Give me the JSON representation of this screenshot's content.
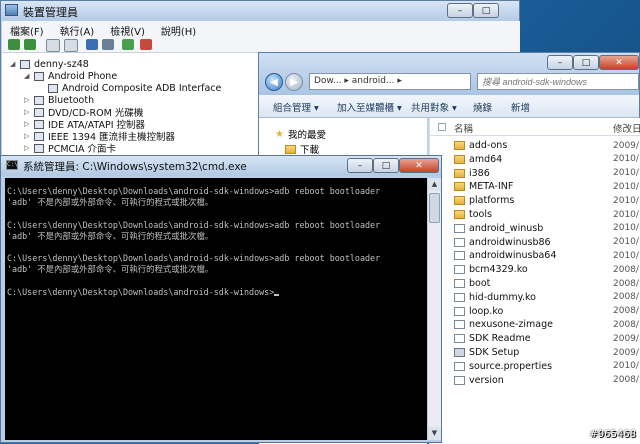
{
  "device_manager": {
    "title": "裝置管理員",
    "menu": [
      "檔案(F)",
      "執行(A)",
      "檢視(V)",
      "說明(H)"
    ],
    "toolbar_icons": [
      "back-arrow-icon",
      "forward-arrow-icon",
      "properties-icon",
      "help-icon",
      "scan-icon",
      "update-driver-icon",
      "uninstall-icon",
      "disable-icon"
    ],
    "tree": [
      {
        "label": "denny-sz48",
        "level": 0,
        "icon": "computer-icon"
      },
      {
        "label": "Android Phone",
        "level": 1,
        "icon": "phone-icon"
      },
      {
        "label": "Android Composite ADB Interface",
        "level": 2,
        "icon": "adb-device-icon"
      },
      {
        "label": "Bluetooth",
        "level": 1,
        "icon": "bluetooth-icon"
      },
      {
        "label": "DVD/CD-ROM 光碟機",
        "level": 1,
        "icon": "cdrom-icon"
      },
      {
        "label": "IDE ATA/ATAPI 控制器",
        "level": 1,
        "icon": "ide-icon"
      },
      {
        "label": "IEEE 1394 匯流排主機控制器",
        "level": 1,
        "icon": "firewire-icon"
      },
      {
        "label": "PCMCIA 介面卡",
        "level": 1,
        "icon": "pcmcia-icon"
      }
    ]
  },
  "explorer": {
    "address": "Dow... ▸ android... ▸",
    "search_placeholder": "搜尋 android-sdk-windows",
    "commands": [
      "組合管理 ▾",
      "加入至媒體櫃 ▾",
      "共用對象 ▾",
      "燒錄",
      "新增"
    ],
    "favorites_label": "我的最愛",
    "downloads_label": "下載",
    "column_name": "名稱",
    "column_date": "修改日",
    "files": [
      {
        "name": "add-ons",
        "type": "folder",
        "date": "2009/"
      },
      {
        "name": "amd64",
        "type": "folder",
        "date": "2010/"
      },
      {
        "name": "i386",
        "type": "folder",
        "date": "2010/"
      },
      {
        "name": "META-INF",
        "type": "folder",
        "date": "2010/"
      },
      {
        "name": "platforms",
        "type": "folder",
        "date": "2010/"
      },
      {
        "name": "tools",
        "type": "folder",
        "date": "2010/"
      },
      {
        "name": "android_winusb",
        "type": "doc",
        "date": "2010/"
      },
      {
        "name": "androidwinusb86",
        "type": "doc",
        "date": "2010/"
      },
      {
        "name": "androidwinusba64",
        "type": "doc",
        "date": "2010/"
      },
      {
        "name": "bcm4329.ko",
        "type": "doc",
        "date": "2008/"
      },
      {
        "name": "boot",
        "type": "doc",
        "date": "2008/"
      },
      {
        "name": "hid-dummy.ko",
        "type": "doc",
        "date": "2008/"
      },
      {
        "name": "loop.ko",
        "type": "doc",
        "date": "2008/"
      },
      {
        "name": "nexusone-zimage",
        "type": "doc",
        "date": "2008/"
      },
      {
        "name": "SDK Readme",
        "type": "doc",
        "date": "2009/"
      },
      {
        "name": "SDK Setup",
        "type": "bat",
        "date": "2009/"
      },
      {
        "name": "source.properties",
        "type": "doc",
        "date": "2010/"
      },
      {
        "name": "version",
        "type": "doc",
        "date": "2008/"
      }
    ]
  },
  "cmd": {
    "title": "系統管理員: C:\\Windows\\system32\\cmd.exe",
    "lines": [
      "C:\\Users\\denny\\Desktop\\Downloads\\android-sdk-windows>adb reboot bootloader",
      "'adb' 不是內部或外部命令、可執行的程式或批次檔。",
      "",
      "C:\\Users\\denny\\Desktop\\Downloads\\android-sdk-windows>adb reboot bootloader",
      "'adb' 不是內部或外部命令、可執行的程式或批次檔。",
      "",
      "C:\\Users\\denny\\Desktop\\Downloads\\android-sdk-windows>adb reboot bootloader",
      "'adb' 不是內部或外部命令、可執行的程式或批次檔。",
      "",
      "C:\\Users\\denny\\Desktop\\Downloads\\android-sdk-windows>"
    ]
  },
  "watermark": "#965468"
}
